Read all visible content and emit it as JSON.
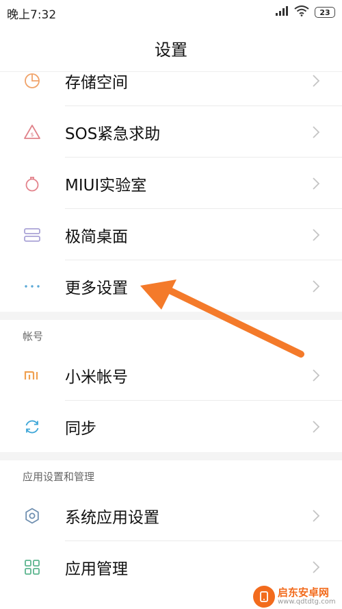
{
  "status_bar": {
    "time": "晚上7:32",
    "battery": "23"
  },
  "header": {
    "title": "设置"
  },
  "group1": {
    "items": [
      {
        "label": "存储空间",
        "icon": "storage-pie-icon"
      },
      {
        "label": "SOS紧急求助",
        "icon": "sos-warning-icon"
      },
      {
        "label": "MIUI实验室",
        "icon": "lab-flask-icon"
      },
      {
        "label": "极简桌面",
        "icon": "simple-home-icon"
      },
      {
        "label": "更多设置",
        "icon": "more-dots-icon"
      }
    ]
  },
  "section_account": {
    "title": "帐号",
    "items": [
      {
        "label": "小米帐号",
        "icon": "mi-logo-icon"
      },
      {
        "label": "同步",
        "icon": "sync-icon"
      }
    ]
  },
  "section_apps": {
    "title": "应用设置和管理",
    "items": [
      {
        "label": "系统应用设置",
        "icon": "gear-icon"
      },
      {
        "label": "应用管理",
        "icon": "app-grid-icon"
      }
    ]
  },
  "annotation": {
    "arrow_color": "#f47a2a"
  },
  "watermark": {
    "name": "启东安卓网",
    "url": "www.qdtdtg.com",
    "color": "#f26b1d"
  }
}
